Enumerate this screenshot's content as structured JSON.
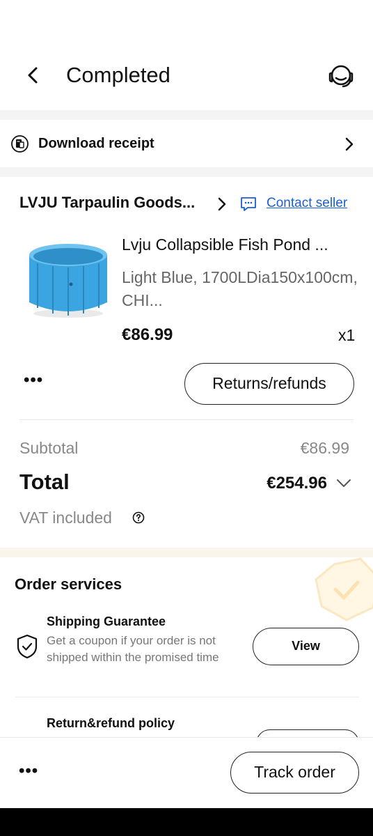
{
  "header": {
    "title": "Completed",
    "back_icon": "chevron-left-icon",
    "support_icon": "headset-icon"
  },
  "receipt": {
    "label": "Download receipt",
    "icon": "receipt-icon"
  },
  "order": {
    "store_name": "LVJU Tarpaulin Goods...",
    "contact_label": "Contact seller",
    "product": {
      "title": "Lvju Collapsible Fish Pond ...",
      "variant": "Light Blue, 1700LDia150x100cm, CHI...",
      "price": "€86.99",
      "quantity": "x1"
    },
    "more_label": "•••",
    "returns_label": "Returns/refunds",
    "subtotal_label": "Subtotal",
    "subtotal_value": "€86.99",
    "total_label": "Total",
    "total_value": "€254.96",
    "vat_label": "VAT included"
  },
  "services": {
    "title": "Order services",
    "shipping": {
      "title": "Shipping Guarantee",
      "description": "Get a coupon if your order is not shipped within the promised time",
      "button": "View"
    },
    "return_policy": {
      "title": "Return&refund policy"
    }
  },
  "bottom_bar": {
    "more_label": "•••",
    "track_label": "Track order"
  },
  "colors": {
    "link": "#1a5fd6",
    "product_blue": "#3aa5e0",
    "muted_text": "#888888",
    "section_gap": "#f4f4f4"
  }
}
